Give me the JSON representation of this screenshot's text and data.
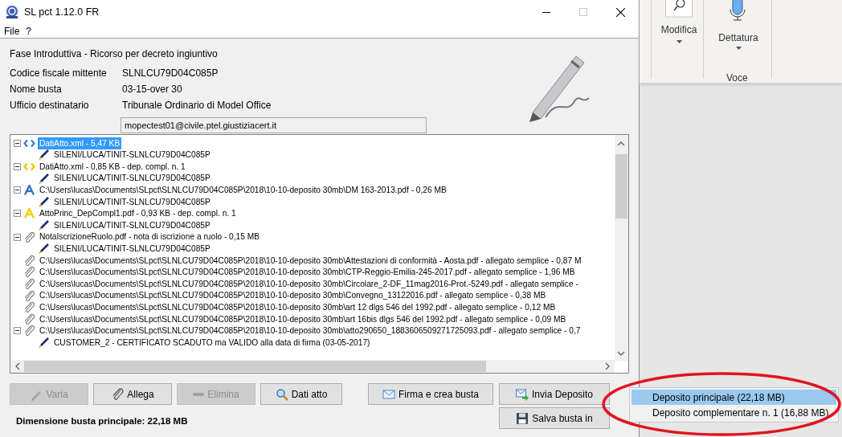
{
  "window": {
    "title": "SL pct 1.12.0 FR"
  },
  "menu": [
    "File",
    "?"
  ],
  "header": {
    "procedure": "Fase Introduttiva - Ricorso per decreto ingiuntivo",
    "fields": [
      {
        "label": "Codice fiscale mittente",
        "value": "SLNLCU79D04C085P"
      },
      {
        "label": "Nome busta",
        "value": "03-15-over 30"
      },
      {
        "label": "Ufficio destinatario",
        "value": "Tribunale Ordinario di Model Office"
      }
    ],
    "address": "mopectest01@civile.ptel.giustiziacert.it"
  },
  "tree": [
    {
      "kind": "xml",
      "color": "#3b7dd8",
      "label": "DatiAtto.xml - 5,47 KB",
      "selected": true,
      "expanded": true,
      "children": [
        {
          "kind": "signature",
          "label": "SILENI/LUCA/TINIT-SLNLCU79D04C085P",
          "selected": false
        }
      ]
    },
    {
      "kind": "xml",
      "color": "#f2c400",
      "label": "DatiAtto.xml - 0,85 KB - dep. compl. n. 1",
      "selected": false,
      "expanded": true,
      "children": [
        {
          "kind": "signature",
          "label": "SILENI/LUCA/TINIT-SLNLCU79D04C085P",
          "selected": false
        }
      ]
    },
    {
      "kind": "atto",
      "color": "#3b6fb6",
      "label": "C:\\Users\\lucas\\Documents\\SLpct\\SLNLCU79D04C085P\\2018\\10-10-deposito 30mb\\DM 163-2013.pdf - 0,26 MB",
      "selected": false,
      "expanded": true,
      "children": [
        {
          "kind": "signature",
          "label": "SILENI/LUCA/TINIT-SLNLCU79D04C085P",
          "selected": false
        }
      ]
    },
    {
      "kind": "atto",
      "color": "#f2d000",
      "label": "AttoPrinc_DepCompl1.pdf - 0,93 KB - dep. compl. n. 1",
      "selected": false,
      "expanded": true,
      "children": [
        {
          "kind": "signature",
          "label": "SILENI/LUCA/TINIT-SLNLCU79D04C085P",
          "selected": false
        }
      ]
    },
    {
      "kind": "attachment",
      "label": "NotaIscrizioneRuolo.pdf - nota di iscrizione a ruolo - 0,15 MB",
      "selected": false,
      "expanded": true,
      "children": [
        {
          "kind": "signature",
          "label": "SILENI/LUCA/TINIT-SLNLCU79D04C085P",
          "selected": false
        }
      ]
    },
    {
      "kind": "attachment",
      "label": "C:\\Users\\lucas\\Documents\\SLpct\\SLNLCU79D04C085P\\2018\\10-10-deposito 30mb\\Attestazioni di conformità - Aosta.pdf - allegato semplice - 0,87 M",
      "selected": false
    },
    {
      "kind": "attachment",
      "label": "C:\\Users\\lucas\\Documents\\SLpct\\SLNLCU79D04C085P\\2018\\10-10-deposito 30mb\\CTP-Reggio-Emilia-245-2017.pdf - allegato semplice - 1,96 MB",
      "selected": false
    },
    {
      "kind": "attachment",
      "label": "C:\\Users\\lucas\\Documents\\SLpct\\SLNLCU79D04C085P\\2018\\10-10-deposito 30mb\\Circolare_2-DF_11mag2016-Prot.-5249.pdf - allegato semplice -",
      "selected": false
    },
    {
      "kind": "attachment",
      "label": "C:\\Users\\lucas\\Documents\\SLpct\\SLNLCU79D04C085P\\2018\\10-10-deposito 30mb\\Convegno_13122016.pdf - allegato semplice - 0,38 MB",
      "selected": false
    },
    {
      "kind": "attachment",
      "label": "C:\\Users\\lucas\\Documents\\SLpct\\SLNLCU79D04C085P\\2018\\10-10-deposito 30mb\\art 12 dlgs 546 del 1992.pdf - allegato semplice - 0,12 MB",
      "selected": false
    },
    {
      "kind": "attachment",
      "label": "C:\\Users\\lucas\\Documents\\SLpct\\SLNLCU79D04C085P\\2018\\10-10-deposito 30mb\\art 16bis dlgs 546 del 1992.pdf - allegato semplice - 0,09 MB",
      "selected": false
    },
    {
      "kind": "attachment",
      "label": "C:\\Users\\lucas\\Documents\\SLpct\\SLNLCU79D04C085P\\2018\\10-10-deposito 30mb\\atto290650_1883606509271725093.pdf - allegato semplice - 0,7",
      "selected": false,
      "expanded": true,
      "children": [
        {
          "kind": "signature",
          "label": "CUSTOMER_2 - CERTIFICATO SCADUTO ma VALIDO alla data di firma (03-05-2017)",
          "selected": false
        }
      ]
    }
  ],
  "buttons": [
    {
      "kind": "pencil",
      "label": "Varia",
      "disabled": true
    },
    {
      "kind": "paperclip",
      "label": "Allega",
      "disabled": false
    },
    {
      "kind": "minus",
      "label": "Elimina",
      "disabled": true
    },
    {
      "kind": "magnifier",
      "label": "Dati atto",
      "disabled": false
    },
    {
      "kind": "envelope",
      "label": "Firma e crea busta",
      "disabled": false
    }
  ],
  "size_note": "Dimensione busta principale: 22,18 MB",
  "deposit_buttons": [
    {
      "kind": "send",
      "label": "Invia Deposito"
    },
    {
      "kind": "floppy",
      "label": "Salva busta in"
    }
  ],
  "send_menu": [
    {
      "label": "Deposito principale (22,18 MB)",
      "selected": true
    },
    {
      "label": "Deposito complementare n. 1 (16,88 MB)",
      "selected": false
    }
  ],
  "ribbon": {
    "buttons": [
      {
        "kind": "find",
        "label": "Modifica"
      },
      {
        "kind": "mic",
        "label": "Dettatura"
      }
    ],
    "group": "Voce"
  }
}
